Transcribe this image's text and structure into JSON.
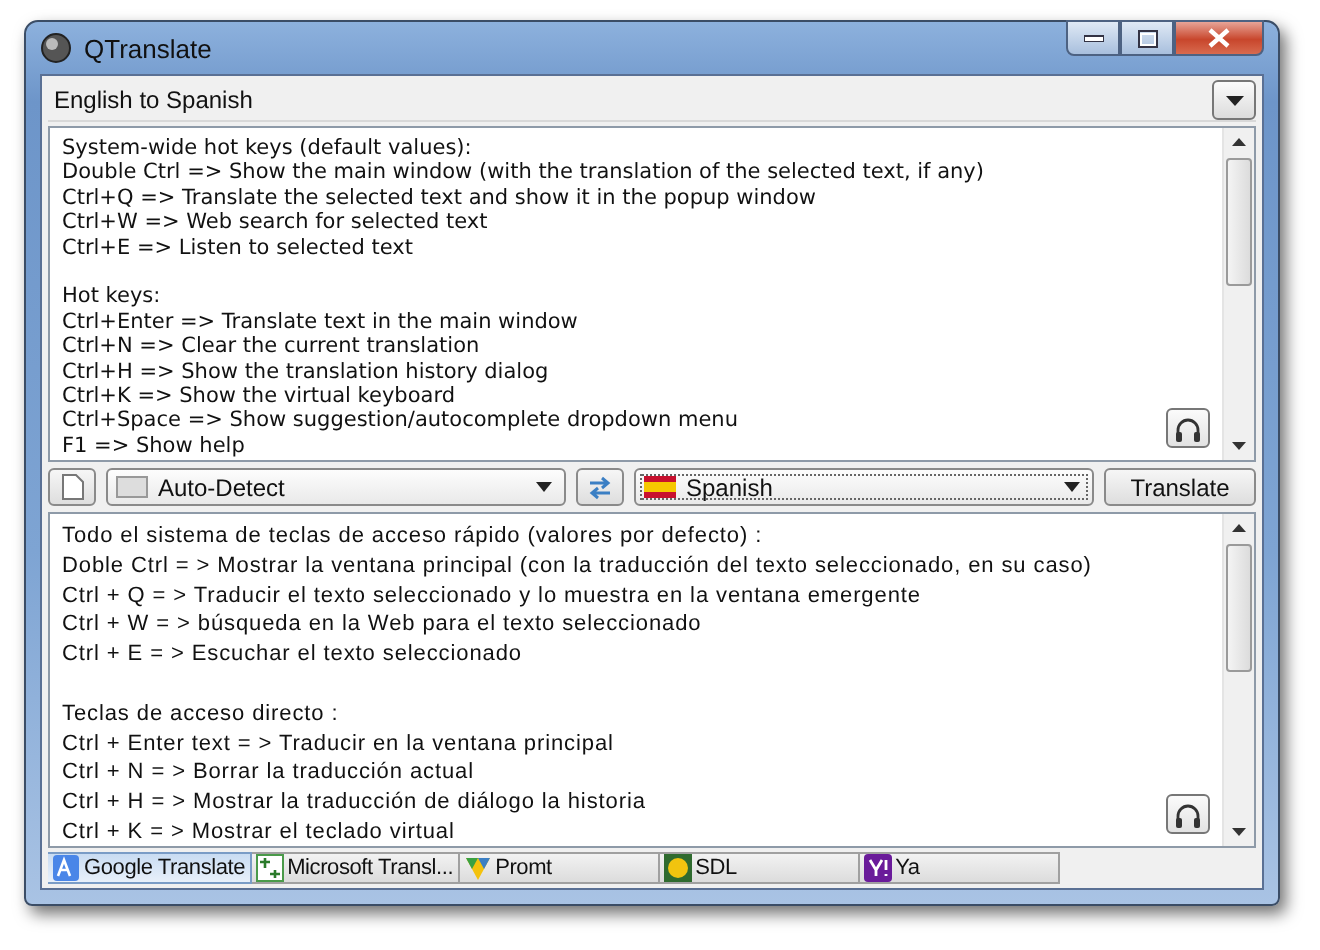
{
  "window": {
    "title": "QTranslate"
  },
  "direction_dropdown": {
    "value": "English to Spanish"
  },
  "source_text": {
    "paragraphs": [
      [
        "System-wide hot keys (default values):",
        "Double Ctrl => Show the main window (with the translation of the selected text, if any)",
        "Ctrl+Q => Translate the selected text and show it in the popup window",
        "Ctrl+W => Web search for selected text",
        "Ctrl+E => Listen to selected text"
      ],
      [
        "Hot keys:",
        "Ctrl+Enter => Translate text in the main window",
        "Ctrl+N => Clear the current translation",
        "Ctrl+H => Show the translation history dialog",
        "Ctrl+K => Show the virtual keyboard",
        "Ctrl+Space => Show suggestion/autocomplete dropdown menu",
        "F1 => Show help"
      ]
    ]
  },
  "toolbar": {
    "source_language": "Auto-Detect",
    "target_language": "Spanish",
    "translate_button": "Translate"
  },
  "target_text": {
    "paragraphs": [
      [
        "Todo el sistema de teclas de acceso rápido (valores por defecto) :",
        "Doble Ctrl = > Mostrar la ventana principal (con la traducción del texto seleccionado, en su caso)",
        "Ctrl + Q = > Traducir el texto seleccionado y lo muestra en la ventana emergente",
        "Ctrl + W = > búsqueda en la Web para el texto seleccionado",
        "Ctrl + E = > Escuchar el texto seleccionado"
      ],
      [
        "Teclas de acceso directo :",
        "Ctrl + Enter text = > Traducir en la ventana principal",
        "Ctrl + N = > Borrar la traducción actual",
        "Ctrl + H = > Mostrar la traducción de diálogo la historia",
        "Ctrl + K = > Mostrar el teclado virtual"
      ]
    ]
  },
  "service_tabs": [
    {
      "label": "Google Translate",
      "selected": true,
      "kind": "google"
    },
    {
      "label": "Microsoft Transl...",
      "selected": false,
      "kind": "microsoft"
    },
    {
      "label": "Promt",
      "selected": false,
      "kind": "promt"
    },
    {
      "label": "SDL",
      "selected": false,
      "kind": "sdl"
    },
    {
      "label": "Ya",
      "selected": false,
      "kind": "yahoo"
    }
  ]
}
